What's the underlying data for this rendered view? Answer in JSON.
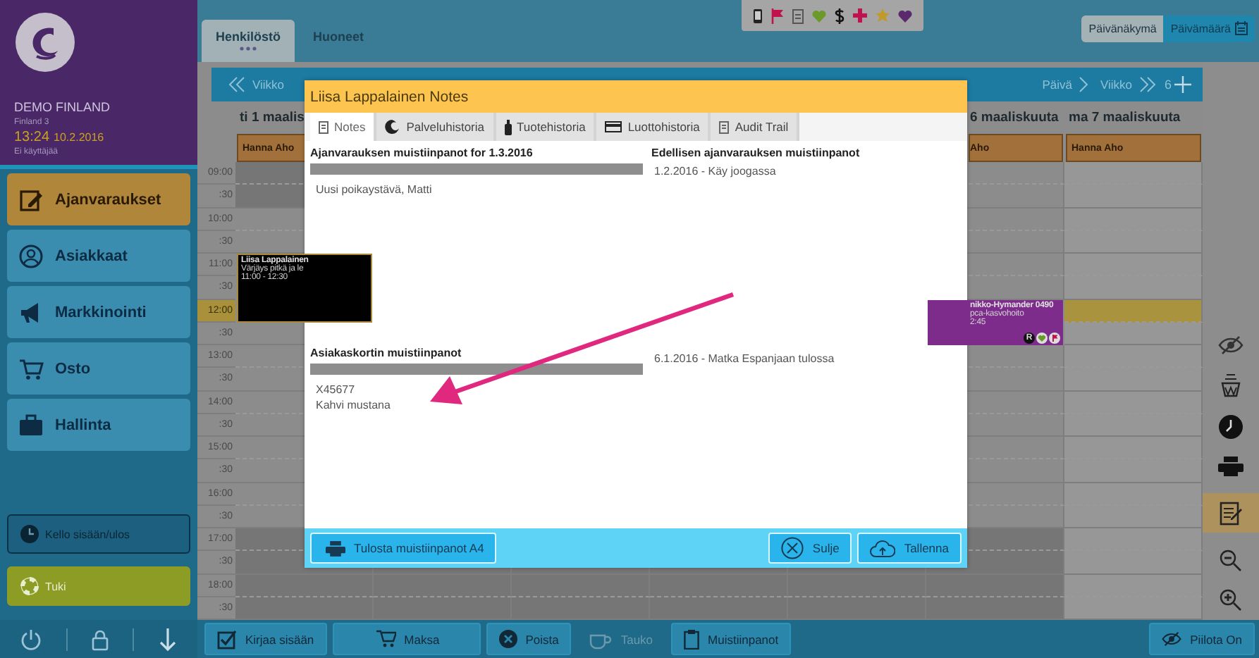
{
  "sidebar": {
    "company": "DEMO FINLAND",
    "location": "Finland 3",
    "time": "13:24",
    "date": "10.2.2016",
    "user": "Ei käyttäjää",
    "nav": [
      {
        "label": "Ajanvaraukset",
        "selected": true
      },
      {
        "label": "Asiakkaat",
        "selected": false
      },
      {
        "label": "Markkinointi",
        "selected": false
      },
      {
        "label": "Osto",
        "selected": false
      },
      {
        "label": "Hallinta",
        "selected": false
      }
    ],
    "actions": [
      {
        "label": "Kello sisään/ulos",
        "kind": "clock"
      },
      {
        "label": "Tuki",
        "kind": "support"
      }
    ]
  },
  "topbar": {
    "tabs": [
      {
        "label": "Henkilöstö",
        "selected": true
      },
      {
        "label": "Huoneet",
        "selected": false
      }
    ],
    "views": [
      {
        "label": "Päivänäkymä",
        "selected": false
      },
      {
        "label": "Päivämäärä",
        "selected": true
      }
    ]
  },
  "navbar": {
    "previous": "Viikko",
    "next_day": "Päivä",
    "next_week": "Viikko",
    "count": "6"
  },
  "calendar": {
    "times": [
      {
        "label": "09:00",
        "current": false
      },
      {
        "label": ":30",
        "current": false
      },
      {
        "label": "10:00",
        "current": false
      },
      {
        "label": ":30",
        "current": false
      },
      {
        "label": "11:00",
        "current": false
      },
      {
        "label": ":30",
        "current": false
      },
      {
        "label": "12:00",
        "current": true
      },
      {
        "label": ":30",
        "current": false
      },
      {
        "label": "13:00",
        "current": false
      },
      {
        "label": ":30",
        "current": false
      },
      {
        "label": "14:00",
        "current": false
      },
      {
        "label": ":30",
        "current": false
      },
      {
        "label": "15:00",
        "current": false
      },
      {
        "label": ":30",
        "current": false
      },
      {
        "label": "16:00",
        "current": false
      },
      {
        "label": ":30",
        "current": false
      },
      {
        "label": "17:00",
        "current": false
      },
      {
        "label": ":30",
        "current": false
      },
      {
        "label": "18:00",
        "current": false
      },
      {
        "label": ":30",
        "current": false
      }
    ],
    "days": [
      {
        "label": "ti 1 maalis",
        "staff": "Hanna Aho"
      },
      {
        "label": "6 maaliskuuta",
        "staff": "Aho"
      },
      {
        "label": "ma 7 maaliskuuta",
        "staff": "Hanna Aho"
      }
    ],
    "events": [
      {
        "client": "Liisa Lappalainen",
        "service": "Värjäys pitkä ja le",
        "time": "11:00 - 12:30",
        "color": "#000000"
      },
      {
        "client": "nikko-Hymander 0490",
        "service": "pca-kasvohoito",
        "time": "2:45",
        "color": "#7e2c8c",
        "badge": "R"
      }
    ]
  },
  "bottom_bar": {
    "buttons": [
      {
        "label": "Kirjaa sisään",
        "disabled": false
      },
      {
        "label": "Maksa",
        "disabled": false
      },
      {
        "label": "Poista",
        "disabled": false
      },
      {
        "label": "Tauko",
        "disabled": true
      },
      {
        "label": "Muistiinpanot",
        "disabled": false
      }
    ],
    "hide": "Piilota On"
  },
  "modal": {
    "title": "Liisa Lappalainen Notes",
    "tabs": [
      {
        "label": "Notes",
        "selected": true
      },
      {
        "label": "Palveluhistoria",
        "selected": false
      },
      {
        "label": "Tuotehistoria",
        "selected": false
      },
      {
        "label": "Luottohistoria",
        "selected": false
      },
      {
        "label": "Audit Trail",
        "selected": false
      }
    ],
    "appointment_notes": {
      "heading": "Ajanvarauksen muistiinpanot for 1.3.2016",
      "value": "Uusi poikaystävä, Matti"
    },
    "client_notes": {
      "heading": "Asiakaskortin muistiinpanot",
      "value": "X45677\nKahvi mustana"
    },
    "previous": {
      "heading": "Edellisen ajanvarauksen muistiinpanot",
      "entries": [
        "1.2.2016 - Käy joogassa",
        "6.1.2016 - Matka Espanjaan tulossa"
      ]
    },
    "print": "Tulosta muistiinpanot A4",
    "close": "Sulje",
    "save": "Tallenna"
  }
}
